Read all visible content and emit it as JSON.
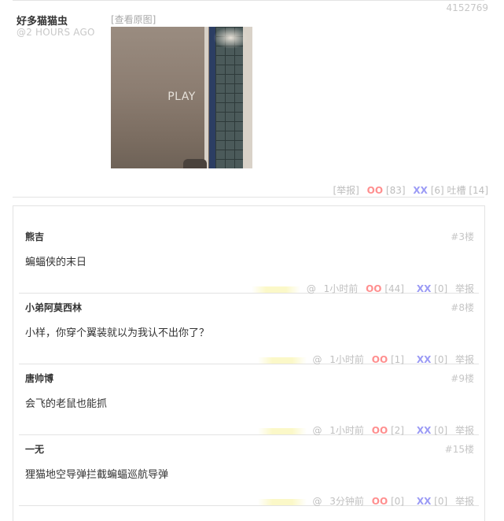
{
  "post": {
    "id": "4152769",
    "author": "好多猫猫虫",
    "time": "@2 HOURS AGO",
    "view_original": "[查看原图]",
    "video_label": "PLAY",
    "actions": {
      "report": "[举报]",
      "oo_label": "OO",
      "oo_count": "[83]",
      "xx_label": "XX",
      "xx_count": "[6]",
      "comments": "吐槽 [14]"
    }
  },
  "comments": [
    {
      "author": "熊吉",
      "floor": "#3楼",
      "text": "蝙蝠侠的末日",
      "at": "@",
      "time": "1小时前",
      "oo_label": "OO",
      "oo": "[44]",
      "xx_label": "XX",
      "xx": "[0]",
      "report": "举报"
    },
    {
      "author": "小弟阿莫西林",
      "floor": "#8楼",
      "text": "小样，你穿个翼装就以为我认不出你了？",
      "at": "@",
      "time": "1小时前",
      "oo_label": "OO",
      "oo": "[1]",
      "xx_label": "XX",
      "xx": "[0]",
      "report": "举报"
    },
    {
      "author": "唐帅博",
      "floor": "#9楼",
      "text": "会飞的老鼠也能抓",
      "at": "@",
      "time": "1小时前",
      "oo_label": "OO",
      "oo": "[2]",
      "xx_label": "XX",
      "xx": "[0]",
      "report": "举报"
    },
    {
      "author": "一无",
      "floor": "#15楼",
      "text": "狸猫地空导弹拦截蝙蝠巡航导弹",
      "at": "@",
      "time": "3分钟前",
      "oo_label": "OO",
      "oo": "[0]",
      "xx_label": "XX",
      "xx": "[0]",
      "report": "举报"
    }
  ],
  "colors": {
    "oo": "#ff8f8f",
    "xx": "#9b9bf5",
    "muted": "#c0c0c0",
    "border": "#e3e3e3"
  }
}
